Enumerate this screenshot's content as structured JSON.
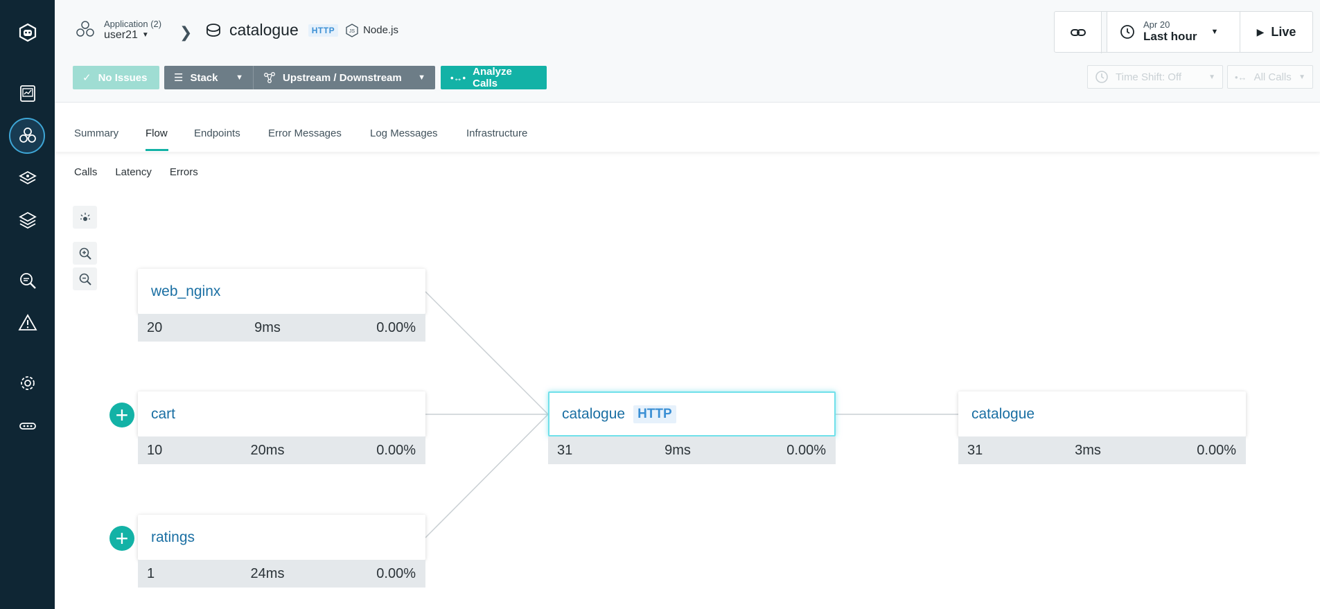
{
  "colors": {
    "accent": "#13b2a6",
    "nav_bg": "#0f2634",
    "link": "#1a6fa3",
    "http_tag": "#3a8fd4"
  },
  "nav": {
    "items": [
      {
        "icon": "robot-logo-icon"
      },
      {
        "icon": "dashboard-icon"
      },
      {
        "icon": "applications-icon"
      },
      {
        "icon": "platforms-icon"
      },
      {
        "icon": "stack-icon"
      },
      {
        "icon": "analytics-icon"
      },
      {
        "icon": "alert-icon"
      },
      {
        "icon": "settings-icon"
      },
      {
        "icon": "more-icon"
      }
    ]
  },
  "header": {
    "app_label": "Application (2)",
    "app_user": "user21",
    "service_title": "catalogue",
    "service_tag": "HTTP",
    "technology": "Node.js",
    "time_date": "Apr 20",
    "time_range": "Last hour",
    "live_label": "Live"
  },
  "toolbar": {
    "no_issues": "No Issues",
    "stack": "Stack",
    "upstream_downstream": "Upstream / Downstream",
    "analyze_calls": "Analyze Calls",
    "time_shift": "Time Shift: Off",
    "all_calls": "All Calls"
  },
  "tabs": [
    "Summary",
    "Flow",
    "Endpoints",
    "Error Messages",
    "Log Messages",
    "Infrastructure"
  ],
  "active_tab": "Flow",
  "subtabs": [
    "Calls",
    "Latency",
    "Errors"
  ],
  "flow": {
    "nodes": [
      {
        "name": "web_nginx",
        "calls": "20",
        "latency": "9ms",
        "errors": "0.00%"
      },
      {
        "name": "cart",
        "calls": "10",
        "latency": "20ms",
        "errors": "0.00%"
      },
      {
        "name": "ratings",
        "calls": "1",
        "latency": "24ms",
        "errors": "0.00%"
      },
      {
        "name": "catalogue",
        "tag": "HTTP",
        "calls": "31",
        "latency": "9ms",
        "errors": "0.00%"
      },
      {
        "name": "catalogue",
        "calls": "31",
        "latency": "3ms",
        "errors": "0.00%"
      }
    ]
  }
}
